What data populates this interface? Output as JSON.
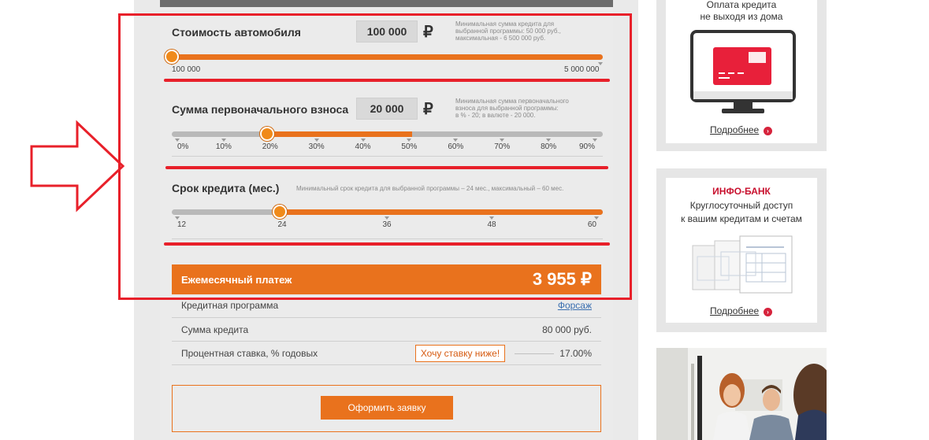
{
  "calculator": {
    "car_cost": {
      "title": "Стоимость автомобиля",
      "value": "100 000",
      "currency": "₽",
      "hint_line1": "Минимальная сумма кредита для",
      "hint_line2": "выбранной программы: 50 000 руб.,",
      "hint_line3": "максимальная - 6 500 000 руб.",
      "slider_level_fraction": 0.0,
      "min_label": "100 000",
      "max_label": "5 000 000"
    },
    "down_payment": {
      "title": "Сумма первоначального взноса",
      "value": "20 000",
      "currency": "₽",
      "hint_line1": "Минимальная сумма первоначального",
      "hint_line2": "взноса для выбранной программы:",
      "hint_line3": "в % - 20; в валюте - 20 000.",
      "selected_percent": 20,
      "ticks": [
        "0%",
        "10%",
        "20%",
        "30%",
        "40%",
        "50%",
        "60%",
        "70%",
        "80%",
        "90%"
      ]
    },
    "term": {
      "title": "Срок кредита (мес.)",
      "hint": "Минимальный срок кредита для выбранной программы – 24 мес., максимальный – 60 мес.",
      "selected_months": 24,
      "ticks": [
        "12",
        "24",
        "36",
        "48",
        "60"
      ]
    },
    "monthly_payment": {
      "label": "Ежемесячный платеж",
      "value": "3 955 ₽"
    },
    "details": {
      "program_label": "Кредитная программа",
      "program_value": "Форсаж",
      "loan_sum_label": "Сумма кредита",
      "loan_sum_value": "80 000 руб.",
      "rate_label": "Процентная ставка, % годовых",
      "rate_button": "Хочу ставку ниже!",
      "rate_value": "17.00%"
    },
    "apply_button": "Оформить заявку"
  },
  "sidebar": {
    "card_payment": {
      "line1": "Оплата кредита",
      "line2": "не выходя из дома",
      "more": "Подробнее",
      "icon": "monitor-card-icon"
    },
    "infobank": {
      "title": "ИНФО-БАНК",
      "line1": "Круглосуточный доступ",
      "line2": "к вашим кредитам и счетам",
      "more": "Подробнее",
      "icon": "documents-icon"
    },
    "photo": {
      "icon": "people-photo"
    }
  },
  "colors": {
    "accent_orange": "#e9721d",
    "annotation_red": "#e8202a",
    "brand_red": "#d6233c"
  }
}
